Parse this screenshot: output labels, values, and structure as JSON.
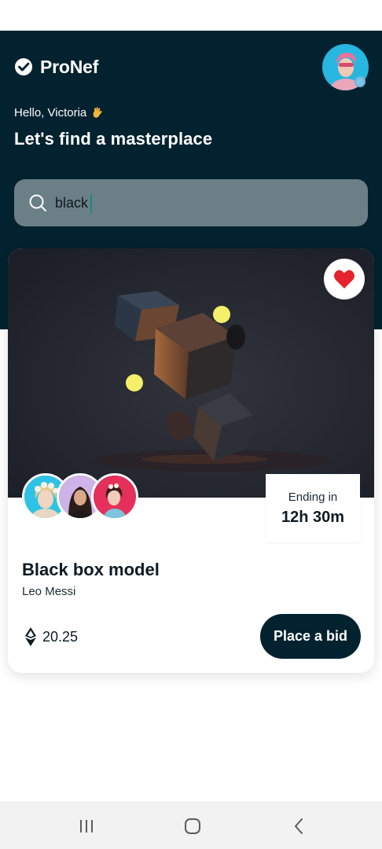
{
  "app": {
    "brand": "ProNef",
    "greeting": "Hello, Victoria",
    "headline": "Let's find a masterplace"
  },
  "search": {
    "value": "black",
    "placeholder": ""
  },
  "card": {
    "title": "Black box model",
    "artist": "Leo Messi",
    "ending_label": "Ending in",
    "ending_time": "12h 30m",
    "price": "20.25",
    "bid_label": "Place a bid",
    "favorited": true
  },
  "icons": {
    "logo": "check-circle-icon",
    "wave": "waving-hand-icon",
    "search": "search-icon",
    "favorite": "heart-icon",
    "currency": "ethereum-icon",
    "nav": [
      "recent-apps-icon",
      "home-icon",
      "back-icon"
    ]
  },
  "colors": {
    "header_bg": "#032230",
    "search_bg": "#6b7f86",
    "accent_heart": "#e5232e",
    "button_bg": "#032230"
  }
}
